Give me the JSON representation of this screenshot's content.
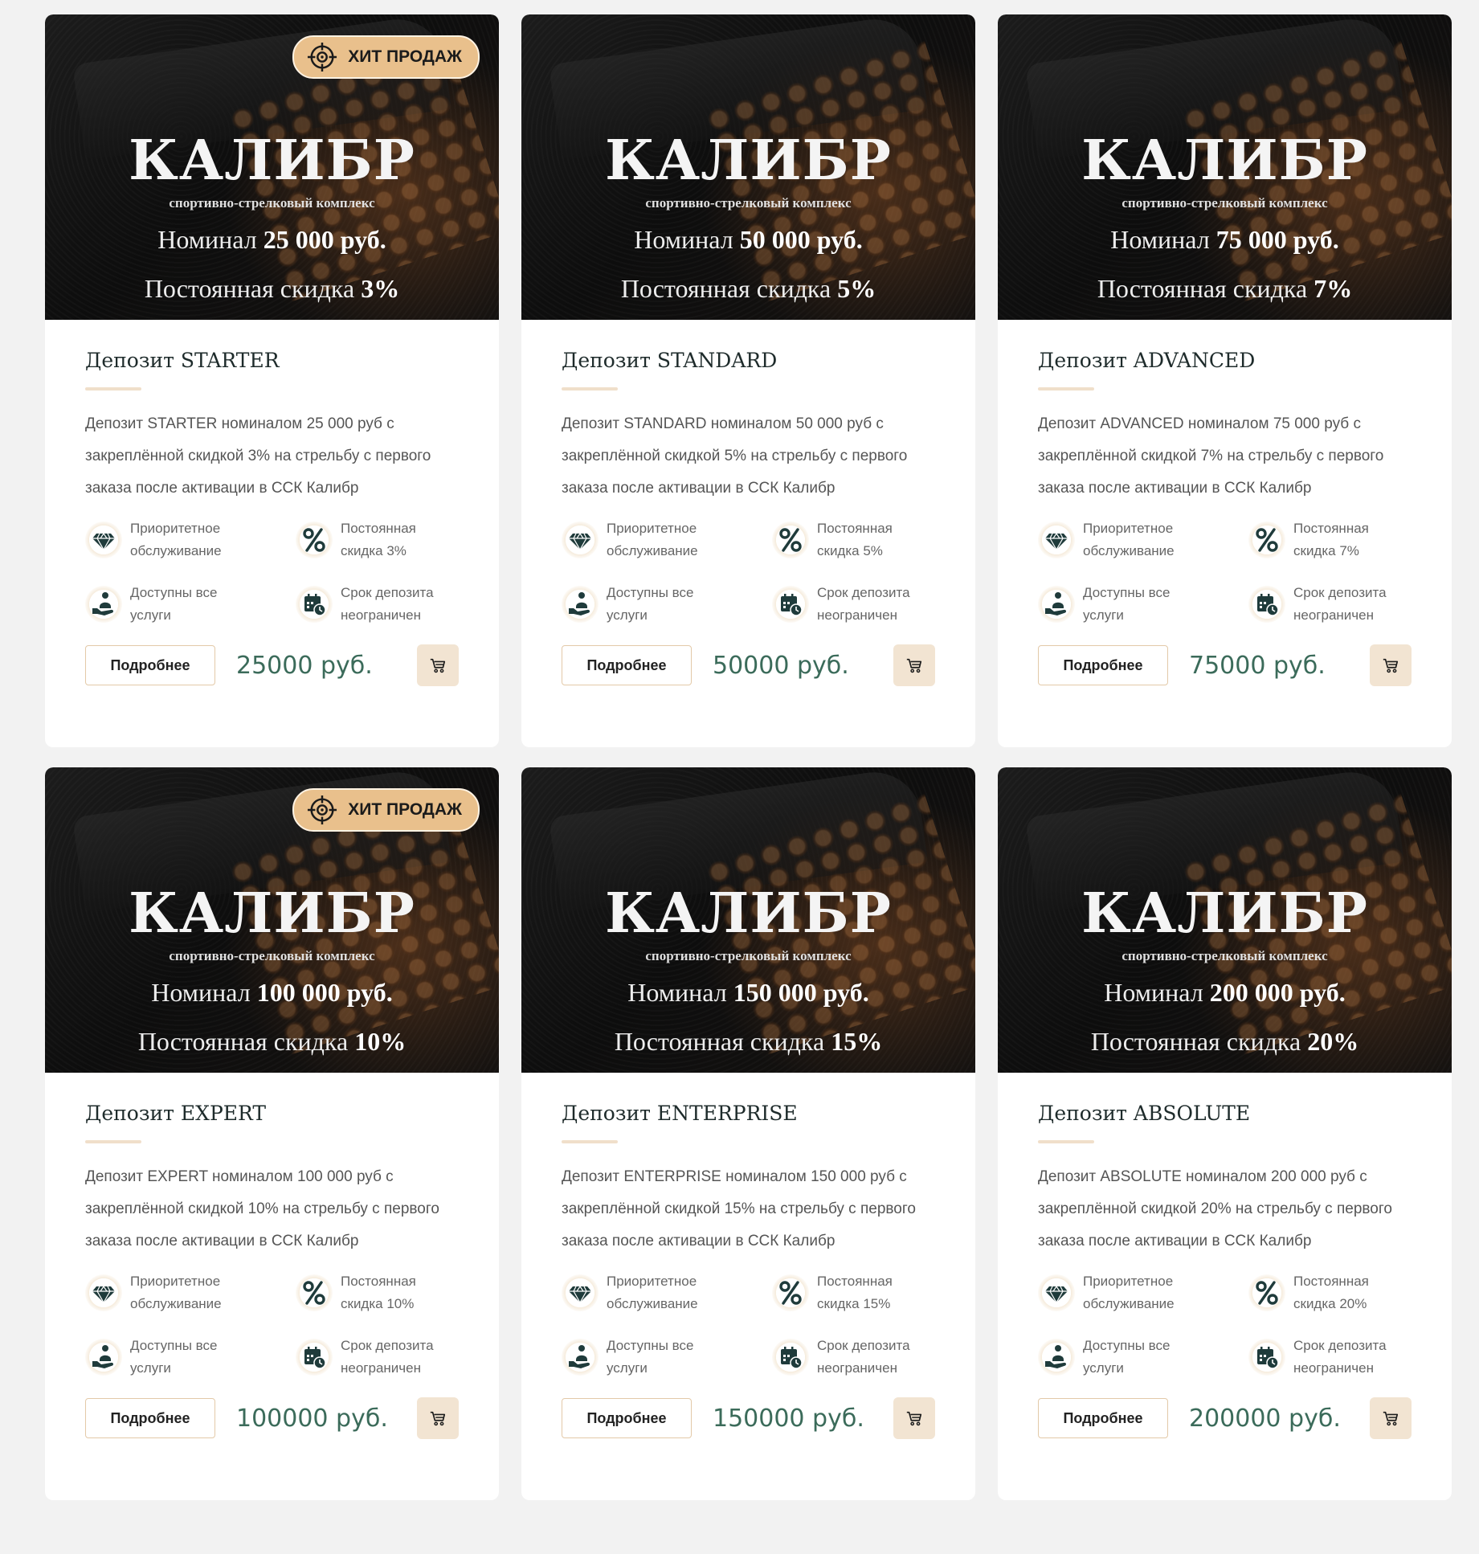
{
  "colors": {
    "page_bg": "#f2f2f2",
    "card_bg": "#ffffff",
    "badge_bg": "#e9c08c",
    "price": "#3b6b5a",
    "cart_bg": "#f2e4d2",
    "icon_dark": "#1f3b3b"
  },
  "cards": [
    {
      "banner": {
        "brand": "КАЛИБР",
        "brand_sub": "спортивно-стрелковый комплекс",
        "nominal_prefix": "Номинал",
        "nominal_value": "25 000 руб.",
        "discount_prefix": "Постоянная скидка",
        "discount_value": "3%"
      },
      "badge": {
        "visible": true,
        "label": "ХИТ ПРОДАЖ",
        "icon": "crosshair-icon"
      },
      "title": "Депозит STARTER",
      "desc": "Депозит STARTER номиналом 25 000 руб с закреплённой скидкой 3% на стрельбу с первого заказа после активации в ССК Калибр",
      "features": [
        {
          "icon": "diamond-icon",
          "line1": "Приоритетное",
          "line2": "обслуживание"
        },
        {
          "icon": "percent-icon",
          "line1": "Постоянная",
          "line2": "скидка 3%"
        },
        {
          "icon": "service-person-icon",
          "line1": "Доступны все",
          "line2": "услуги"
        },
        {
          "icon": "calendar-clock-icon",
          "line1": "Срок депозита",
          "line2": "неограничен"
        }
      ],
      "more_label": "Подробнее",
      "price": "25000 руб.",
      "cart_icon": "cart-icon"
    },
    {
      "banner": {
        "brand": "КАЛИБР",
        "brand_sub": "спортивно-стрелковый комплекс",
        "nominal_prefix": "Номинал",
        "nominal_value": "50 000 руб.",
        "discount_prefix": "Постоянная скидка",
        "discount_value": "5%"
      },
      "badge": {
        "visible": false,
        "label": "",
        "icon": ""
      },
      "title": "Депозит STANDARD",
      "desc": "Депозит STANDARD номиналом 50 000 руб с закреплённой скидкой 5% на стрельбу с первого заказа после активации в ССК Калибр",
      "features": [
        {
          "icon": "diamond-icon",
          "line1": "Приоритетное",
          "line2": "обслуживание"
        },
        {
          "icon": "percent-icon",
          "line1": "Постоянная",
          "line2": "скидка 5%"
        },
        {
          "icon": "service-person-icon",
          "line1": "Доступны все",
          "line2": "услуги"
        },
        {
          "icon": "calendar-clock-icon",
          "line1": "Срок депозита",
          "line2": "неограничен"
        }
      ],
      "more_label": "Подробнее",
      "price": "50000 руб.",
      "cart_icon": "cart-icon"
    },
    {
      "banner": {
        "brand": "КАЛИБР",
        "brand_sub": "спортивно-стрелковый комплекс",
        "nominal_prefix": "Номинал",
        "nominal_value": "75 000 руб.",
        "discount_prefix": "Постоянная скидка",
        "discount_value": "7%"
      },
      "badge": {
        "visible": false,
        "label": "",
        "icon": ""
      },
      "title": "Депозит ADVANCED",
      "desc": "Депозит ADVANCED номиналом 75 000 руб с закреплённой скидкой 7% на стрельбу с первого заказа после активации в ССК Калибр",
      "features": [
        {
          "icon": "diamond-icon",
          "line1": "Приоритетное",
          "line2": "обслуживание"
        },
        {
          "icon": "percent-icon",
          "line1": "Постоянная",
          "line2": "скидка 7%"
        },
        {
          "icon": "service-person-icon",
          "line1": "Доступны все",
          "line2": "услуги"
        },
        {
          "icon": "calendar-clock-icon",
          "line1": "Срок депозита",
          "line2": "неограничен"
        }
      ],
      "more_label": "Подробнее",
      "price": "75000 руб.",
      "cart_icon": "cart-icon"
    },
    {
      "banner": {
        "brand": "КАЛИБР",
        "brand_sub": "спортивно-стрелковый комплекс",
        "nominal_prefix": "Номинал",
        "nominal_value": "100 000 руб.",
        "discount_prefix": "Постоянная скидка",
        "discount_value": "10%"
      },
      "badge": {
        "visible": true,
        "label": "ХИТ ПРОДАЖ",
        "icon": "crosshair-icon"
      },
      "title": "Депозит EXPERT",
      "desc": "Депозит EXPERT номиналом 100 000 руб с закреплённой скидкой 10% на стрельбу с первого заказа после активации в ССК Калибр",
      "features": [
        {
          "icon": "diamond-icon",
          "line1": "Приоритетное",
          "line2": "обслуживание"
        },
        {
          "icon": "percent-icon",
          "line1": "Постоянная",
          "line2": "скидка 10%"
        },
        {
          "icon": "service-person-icon",
          "line1": "Доступны все",
          "line2": "услуги"
        },
        {
          "icon": "calendar-clock-icon",
          "line1": "Срок депозита",
          "line2": "неограничен"
        }
      ],
      "more_label": "Подробнее",
      "price": "100000 руб.",
      "cart_icon": "cart-icon"
    },
    {
      "banner": {
        "brand": "КАЛИБР",
        "brand_sub": "спортивно-стрелковый комплекс",
        "nominal_prefix": "Номинал",
        "nominal_value": "150 000 руб.",
        "discount_prefix": "Постоянная скидка",
        "discount_value": "15%"
      },
      "badge": {
        "visible": false,
        "label": "",
        "icon": ""
      },
      "title": "Депозит ENTERPRISE",
      "desc": "Депозит ENTERPRISE номиналом 150 000 руб с закреплённой скидкой 15% на стрельбу с первого заказа после активации в ССК Калибр",
      "features": [
        {
          "icon": "diamond-icon",
          "line1": "Приоритетное",
          "line2": "обслуживание"
        },
        {
          "icon": "percent-icon",
          "line1": "Постоянная",
          "line2": "скидка 15%"
        },
        {
          "icon": "service-person-icon",
          "line1": "Доступны все",
          "line2": "услуги"
        },
        {
          "icon": "calendar-clock-icon",
          "line1": "Срок депозита",
          "line2": "неограничен"
        }
      ],
      "more_label": "Подробнее",
      "price": "150000 руб.",
      "cart_icon": "cart-icon"
    },
    {
      "banner": {
        "brand": "КАЛИБР",
        "brand_sub": "спортивно-стрелковый комплекс",
        "nominal_prefix": "Номинал",
        "nominal_value": "200 000 руб.",
        "discount_prefix": "Постоянная скидка",
        "discount_value": "20%"
      },
      "badge": {
        "visible": false,
        "label": "",
        "icon": ""
      },
      "title": "Депозит ABSOLUTE",
      "desc": "Депозит ABSOLUTE номиналом 200 000 руб с закреплённой скидкой 20% на стрельбу с первого заказа после активации в ССК Калибр",
      "features": [
        {
          "icon": "diamond-icon",
          "line1": "Приоритетное",
          "line2": "обслуживание"
        },
        {
          "icon": "percent-icon",
          "line1": "Постоянная",
          "line2": "скидка 20%"
        },
        {
          "icon": "service-person-icon",
          "line1": "Доступны все",
          "line2": "услуги"
        },
        {
          "icon": "calendar-clock-icon",
          "line1": "Срок депозита",
          "line2": "неограничен"
        }
      ],
      "more_label": "Подробнее",
      "price": "200000 руб.",
      "cart_icon": "cart-icon"
    }
  ]
}
